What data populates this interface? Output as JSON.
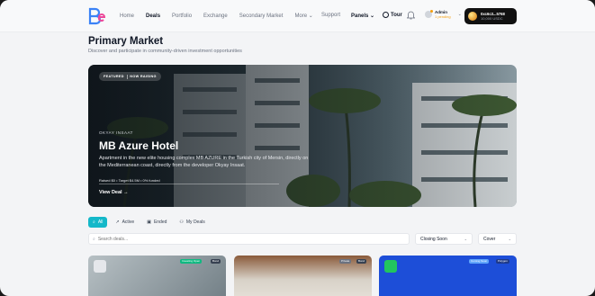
{
  "header": {
    "nav": [
      "Home",
      "Deals",
      "Portfolio",
      "Exchange",
      "Secondary Market",
      "More"
    ],
    "active_nav": "Deals",
    "support": "Support",
    "panels": "Panels",
    "tour": "Tour",
    "admin_name": "Admin",
    "admin_status": "1 pending",
    "wallet_address": "0xc6c3...5768",
    "wallet_balance": "10,000 USDC"
  },
  "page": {
    "title": "Primary Market",
    "subtitle": "Discover and participate in community-driven investment opportunities"
  },
  "hero": {
    "badge_1": "FEATURED",
    "badge_2": "NOW RAISING",
    "org": "OKYAY INSAAT",
    "name": "MB Azure Hotel",
    "description": "Apartment in the new elite housing complex MB AZURE in the Turkish city of Mersin, directly on the Mediterranean coast, directly from the developer Okyay Insaat.",
    "stats": "Raised $0 • Target $4.5M • 0% funded",
    "cta": "View Deal →"
  },
  "filters": {
    "tabs": [
      "All",
      "Active",
      "Ended",
      "My Deals"
    ],
    "active_tab": "All"
  },
  "search": {
    "placeholder": "Search deals..."
  },
  "sort": {
    "value": "Closing Soon"
  },
  "view": {
    "value": "Cover"
  },
  "cards": [
    {
      "tags": [
        "Investing Open",
        "Bond"
      ]
    },
    {
      "tags": [
        "Private",
        "Bond"
      ]
    },
    {
      "tags": [
        "Coming Soon",
        "Polygon"
      ]
    }
  ],
  "colors": {
    "accent": "#14b8c9",
    "wallet_bg": "#111111",
    "pending": "#f59e0b"
  }
}
